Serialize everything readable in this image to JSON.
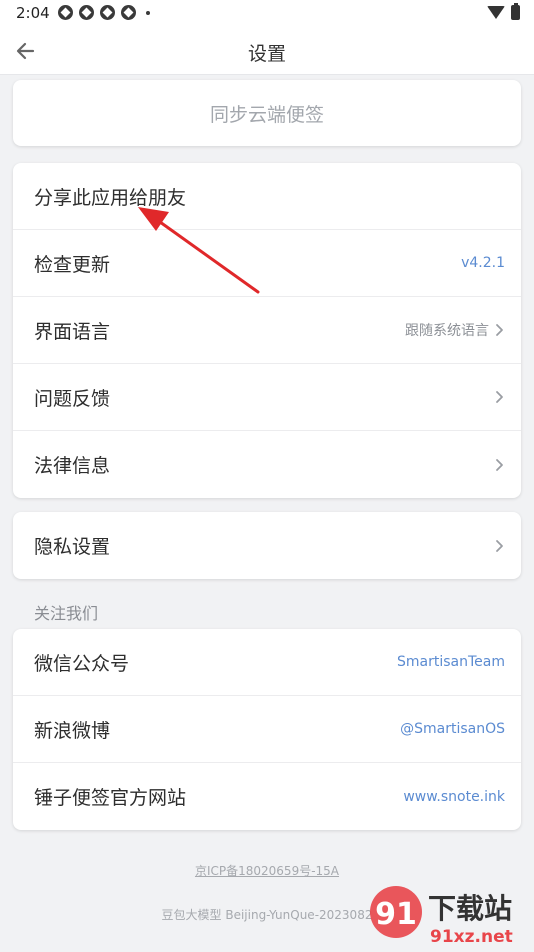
{
  "status": {
    "time": "2:04"
  },
  "header": {
    "title": "设置"
  },
  "sync": {
    "label": "同步云端便签"
  },
  "group1": [
    {
      "label": "分享此应用给朋友",
      "value": ""
    },
    {
      "label": "检查更新",
      "value": "v4.2.1"
    },
    {
      "label": "界面语言",
      "value": "跟随系统语言"
    },
    {
      "label": "问题反馈",
      "value": ""
    },
    {
      "label": "法律信息",
      "value": ""
    }
  ],
  "group2": [
    {
      "label": "隐私设置",
      "value": ""
    }
  ],
  "follow": {
    "title": "关注我们",
    "items": [
      {
        "label": "微信公众号",
        "value": "SmartisanTeam"
      },
      {
        "label": "新浪微博",
        "value": "@SmartisanOS"
      },
      {
        "label": "锤子便签官方网站",
        "value": "www.snote.ink"
      }
    ]
  },
  "footer": {
    "icp": "京ICP备18020659号-15A",
    "version": "豆包大模型 Beijing-YunQue-2023082"
  },
  "watermark": {
    "text1": "下载站",
    "text2": "91xz.net"
  },
  "colors": {
    "accent": "#5b8bd1",
    "arrow": "#e0282a"
  }
}
